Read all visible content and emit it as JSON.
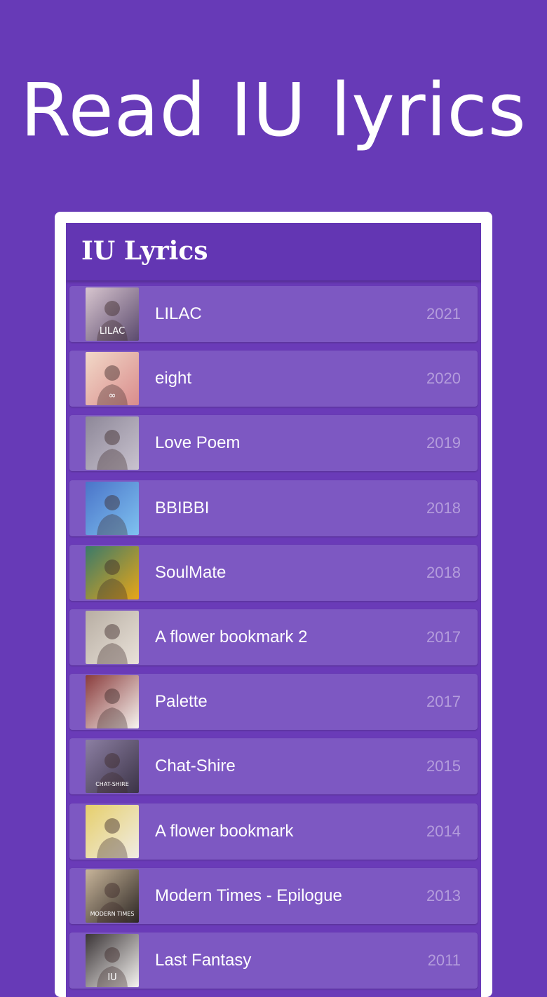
{
  "promo": {
    "title": "Read IU lyrics"
  },
  "app": {
    "title": "IU Lyrics"
  },
  "colors": {
    "background": "#673ab7",
    "app_bar": "#6336b3",
    "row": "#7d58c2",
    "year_text": "#b49ddc"
  },
  "albums": [
    {
      "name": "LILAC",
      "year": "2021",
      "cover_text": "LILAC",
      "cover_colors": [
        "#5b4a6e",
        "#d8c6cf"
      ]
    },
    {
      "name": "eight",
      "year": "2020",
      "cover_text": "∞",
      "cover_colors": [
        "#d98c8c",
        "#f2d9c8"
      ]
    },
    {
      "name": "Love Poem",
      "year": "2019",
      "cover_text": "",
      "cover_colors": [
        "#c9c3cf",
        "#8d8798"
      ]
    },
    {
      "name": "BBIBBI",
      "year": "2018",
      "cover_text": "",
      "cover_colors": [
        "#7fc2f0",
        "#4a74c9"
      ]
    },
    {
      "name": "SoulMate",
      "year": "2018",
      "cover_text": "",
      "cover_colors": [
        "#e8a618",
        "#3a7a6a"
      ]
    },
    {
      "name": "A flower bookmark 2",
      "year": "2017",
      "cover_text": "",
      "cover_colors": [
        "#e9e2d9",
        "#b8aea3"
      ]
    },
    {
      "name": "Palette",
      "year": "2017",
      "cover_text": "",
      "cover_colors": [
        "#f7f4f0",
        "#8a3c3c"
      ]
    },
    {
      "name": "Chat-Shire",
      "year": "2015",
      "cover_text": "CHAT-SHIRE",
      "cover_colors": [
        "#3b3346",
        "#8c7fa3"
      ]
    },
    {
      "name": "A flower bookmark",
      "year": "2014",
      "cover_text": "",
      "cover_colors": [
        "#f0ece4",
        "#e6cf6b"
      ]
    },
    {
      "name": "Modern Times - Epilogue",
      "year": "2013",
      "cover_text": "MODERN TIMES",
      "cover_colors": [
        "#2b2522",
        "#c8b59a"
      ]
    },
    {
      "name": "Last Fantasy",
      "year": "2011",
      "cover_text": "IU",
      "cover_colors": [
        "#f5f3f0",
        "#3a3436"
      ]
    }
  ]
}
